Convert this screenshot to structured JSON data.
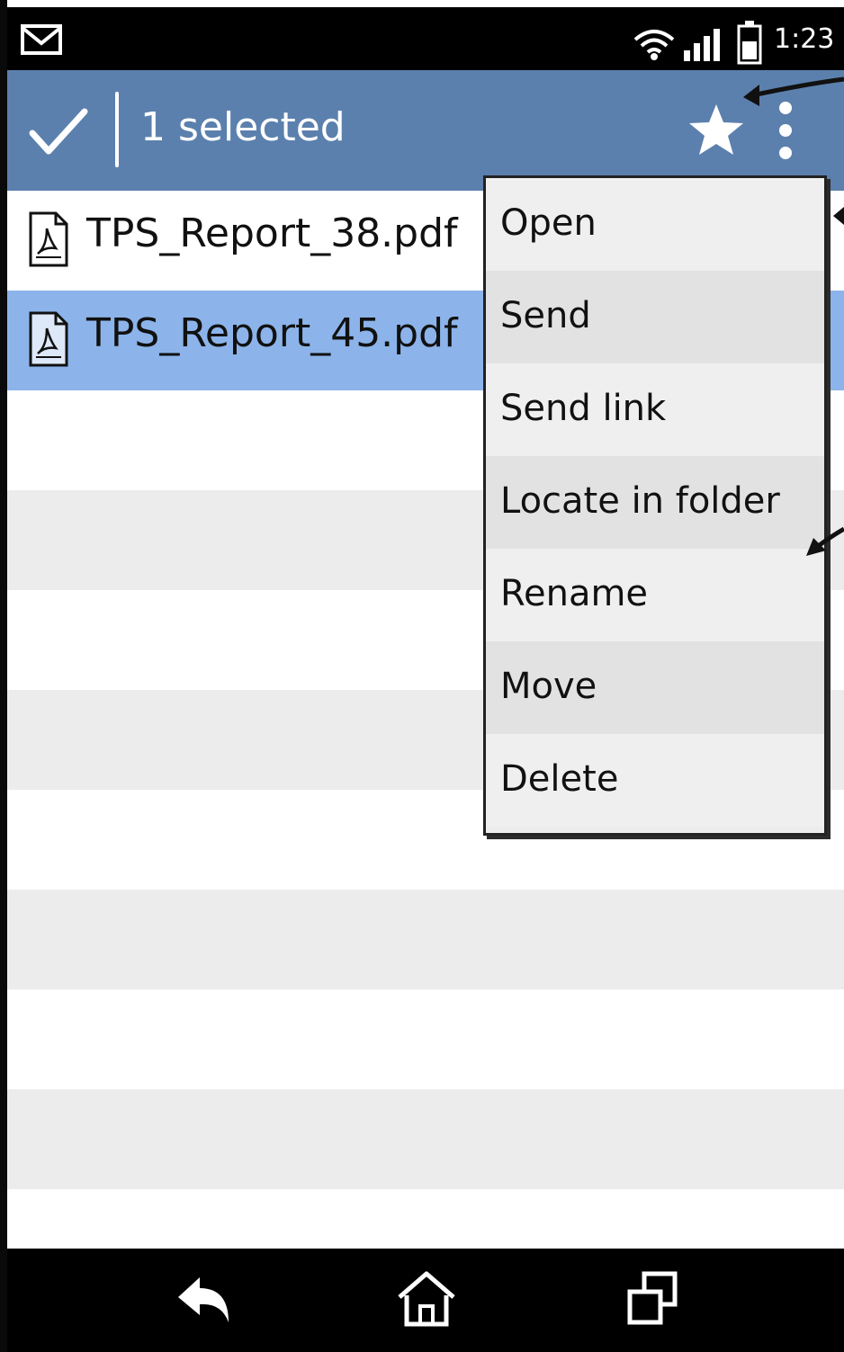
{
  "status_bar": {
    "time": "1:23",
    "icons": [
      "mail-icon",
      "wifi-icon",
      "signal-icon",
      "battery-icon"
    ]
  },
  "action_bar": {
    "title": "1 selected",
    "icons": [
      "check-icon",
      "star-icon",
      "overflow-menu-icon"
    ]
  },
  "files": [
    {
      "name": "TPS_Report_38.pdf",
      "icon": "pdf-icon",
      "selected": false
    },
    {
      "name": "TPS_Report_45.pdf",
      "icon": "pdf-icon",
      "selected": true
    }
  ],
  "menu": {
    "items": [
      "Open",
      "Send",
      "Send link",
      "Locate in folder",
      "Rename",
      "Move",
      "Delete"
    ]
  },
  "nav_bar": {
    "icons": [
      "back-icon",
      "home-icon",
      "recent-apps-icon"
    ]
  },
  "colors": {
    "action_bar": "#5b80ad",
    "selected_row": "#8cb4ea",
    "stripe": "#ececec",
    "menu": "#ececec"
  }
}
